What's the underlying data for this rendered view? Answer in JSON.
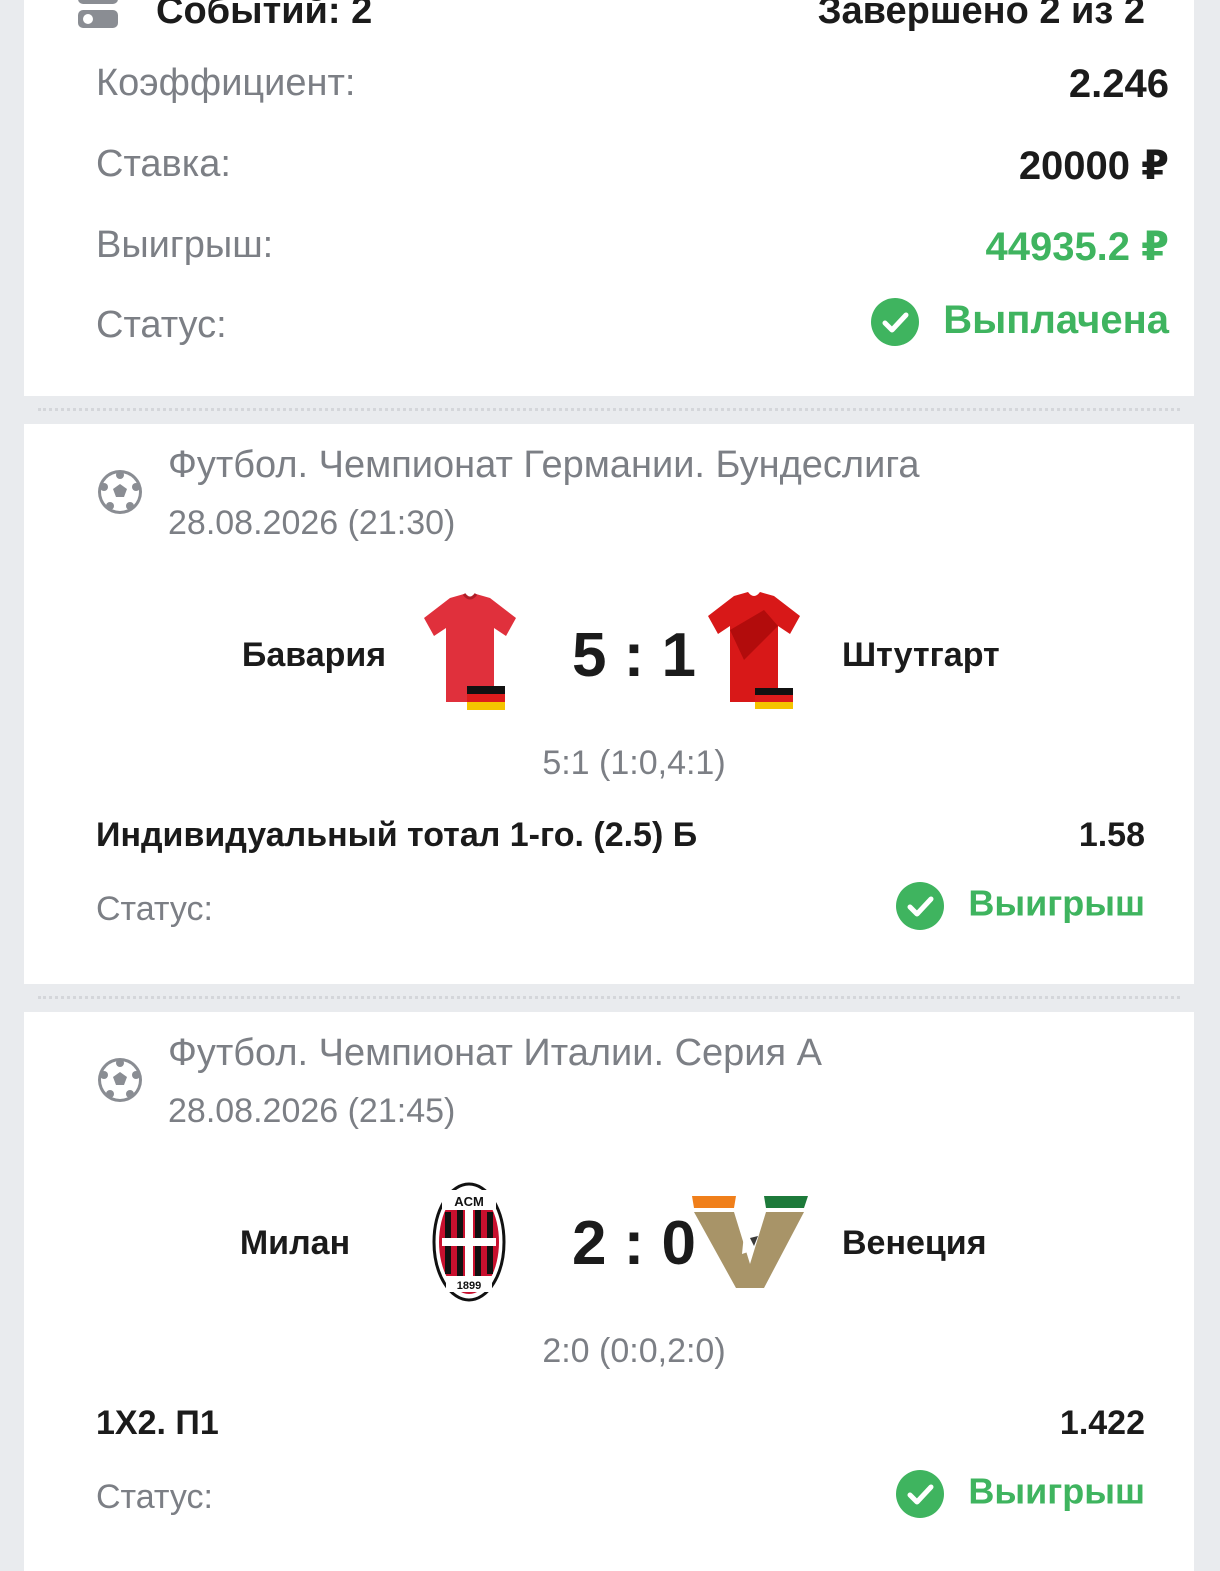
{
  "summary": {
    "events_label": "Событий: 2",
    "completed_label": "Завершено 2 из 2",
    "coef_label": "Коэффициент:",
    "coef_value": "2.246",
    "stake_label": "Ставка:",
    "stake_value": "20000 ₽",
    "win_label": "Выигрыш:",
    "win_value": "44935.2 ₽",
    "status_label": "Статус:",
    "status_value": "Выплачена"
  },
  "events": [
    {
      "league": "Футбол. Чемпионат Германии. Бундеслига",
      "date": "28.08.2026 (21:30)",
      "home": "Бавария",
      "away": "Штутгарт",
      "score": "5 : 1",
      "detail": "5:1 (1:0,4:1)",
      "bet": "Индивидуальный тотал 1-го. (2.5) Б",
      "odd": "1.58",
      "status_label": "Статус:",
      "status_value": "Выигрыш"
    },
    {
      "league": "Футбол. Чемпионат Италии. Серия А",
      "date": "28.08.2026 (21:45)",
      "home": "Милан",
      "away": "Венеция",
      "score": "2 : 0",
      "detail": "2:0 (0:0,2:0)",
      "bet": "1X2. П1",
      "odd": "1.422",
      "status_label": "Статус:",
      "status_value": "Выигрыш"
    }
  ],
  "colors": {
    "win_green": "#3fb45f",
    "muted_text": "#7c7f85",
    "background": "#e9ebee"
  },
  "logos": {
    "milan_badge_text": "ACM",
    "milan_badge_year": "1899"
  },
  "icons": [
    "events-icon",
    "check-circle-icon",
    "soccer-ball-icon",
    "jersey-icon",
    "germany-flag-icon",
    "milan-badge-icon",
    "venezia-badge-icon"
  ]
}
